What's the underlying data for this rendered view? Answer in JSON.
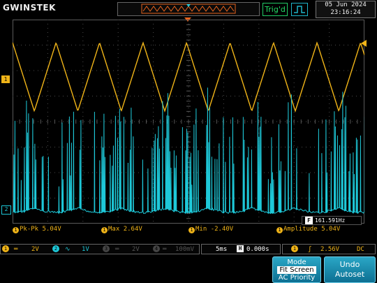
{
  "brand": "GWINSTEK",
  "header": {
    "trig_status": "Trig'd",
    "date": "05 Jun 2024",
    "time": "23:16:24"
  },
  "markers": {
    "ch1_marker": "1",
    "ch2_marker": "2"
  },
  "frequency_readout": {
    "badge": "F",
    "value": "161.591Hz"
  },
  "measurements": [
    {
      "badge": "1",
      "label": "Pk-Pk",
      "value": "5.04V"
    },
    {
      "badge": "1",
      "label": "Max",
      "value": "2.64V"
    },
    {
      "badge": "1",
      "label": "Min",
      "value": "-2.40V"
    },
    {
      "badge": "1",
      "label": "Amplitude",
      "value": "5.04V"
    }
  ],
  "status_bar": {
    "ch1": {
      "num": "1",
      "coupling": "═",
      "scale": "2V"
    },
    "ch2": {
      "num": "2",
      "coupling": "∿",
      "scale": "1V"
    },
    "ch3": {
      "num": "3",
      "coupling": "═",
      "scale": "2V"
    },
    "ch4": {
      "num": "4",
      "coupling": "═",
      "scale": "100mV"
    },
    "timebase": "5ms",
    "h_badge": "H",
    "h_position": "0.000s",
    "trig_source": "1",
    "trig_slope": "ʃ",
    "trig_level": "2.56V",
    "trig_coupling": "DC"
  },
  "menu": {
    "mode_title": "Mode",
    "mode_opt1": "Fit Screen",
    "mode_opt2": "AC Priority",
    "undo_line1": "Undo",
    "undo_line2": "Autoset"
  },
  "colors": {
    "ch1": "#f0b418",
    "ch2": "#1ec8d8",
    "grid": "#5a5a5a",
    "trig": "#22dd66"
  }
}
